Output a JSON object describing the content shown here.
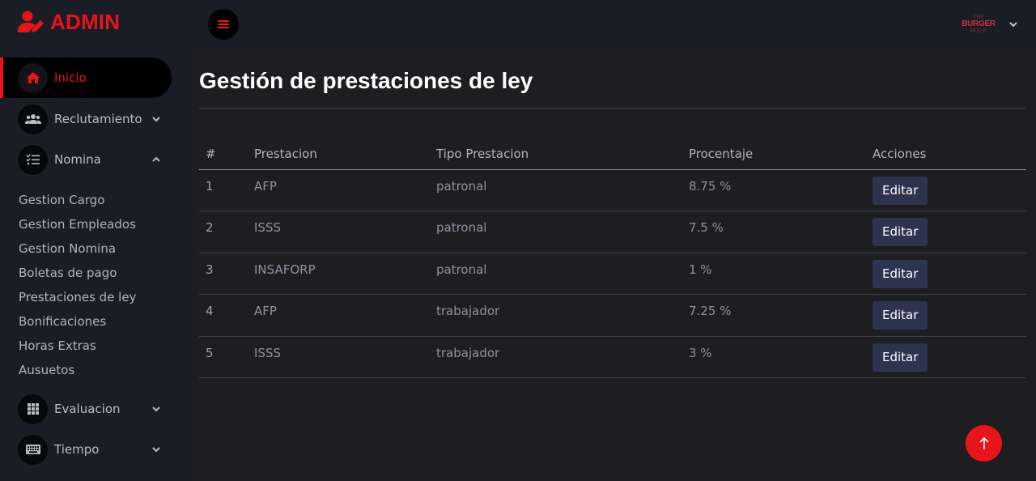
{
  "brand": {
    "title": "ADMIN",
    "accent_color": "#e8141b"
  },
  "sidebar": {
    "items": [
      {
        "label": "Inicio",
        "icon": "home-icon",
        "active": true
      },
      {
        "label": "Reclutamiento",
        "icon": "users-icon",
        "expanded": false
      },
      {
        "label": "Nomina",
        "icon": "list-check-icon",
        "expanded": true
      },
      {
        "label": "Evaluacion",
        "icon": "grid-icon",
        "expanded": false
      },
      {
        "label": "Tiempo",
        "icon": "keyboard-icon",
        "expanded": false
      }
    ],
    "nomina_sub": [
      "Gestion Cargo",
      "Gestion Empleados",
      "Gestion Nomina",
      "Boletas de pago",
      "Prestaciones de ley",
      "Bonificaciones",
      "Horas Extras",
      "Ausuetos"
    ]
  },
  "topbar": {
    "menu_icon": "hamburger-icon",
    "avatar_lines": [
      "THE",
      "BURGER",
      "ROCK"
    ]
  },
  "main": {
    "title": "Gestión de prestaciones de ley",
    "table": {
      "headers": [
        "#",
        "Prestacion",
        "Tipo Prestacion",
        "Procentaje",
        "Acciones"
      ],
      "rows": [
        {
          "num": "1",
          "prestacion": "AFP",
          "tipo": "patronal",
          "porcentaje": "8.75 %",
          "action": "Editar"
        },
        {
          "num": "2",
          "prestacion": "ISSS",
          "tipo": "patronal",
          "porcentaje": "7.5 %",
          "action": "Editar"
        },
        {
          "num": "3",
          "prestacion": "INSAFORP",
          "tipo": "patronal",
          "porcentaje": "1 %",
          "action": "Editar"
        },
        {
          "num": "4",
          "prestacion": "AFP",
          "tipo": "trabajador",
          "porcentaje": "7.25 %",
          "action": "Editar"
        },
        {
          "num": "5",
          "prestacion": "ISSS",
          "tipo": "trabajador",
          "porcentaje": "3 %",
          "action": "Editar"
        }
      ]
    }
  },
  "fab": {
    "icon": "arrow-up-icon"
  }
}
